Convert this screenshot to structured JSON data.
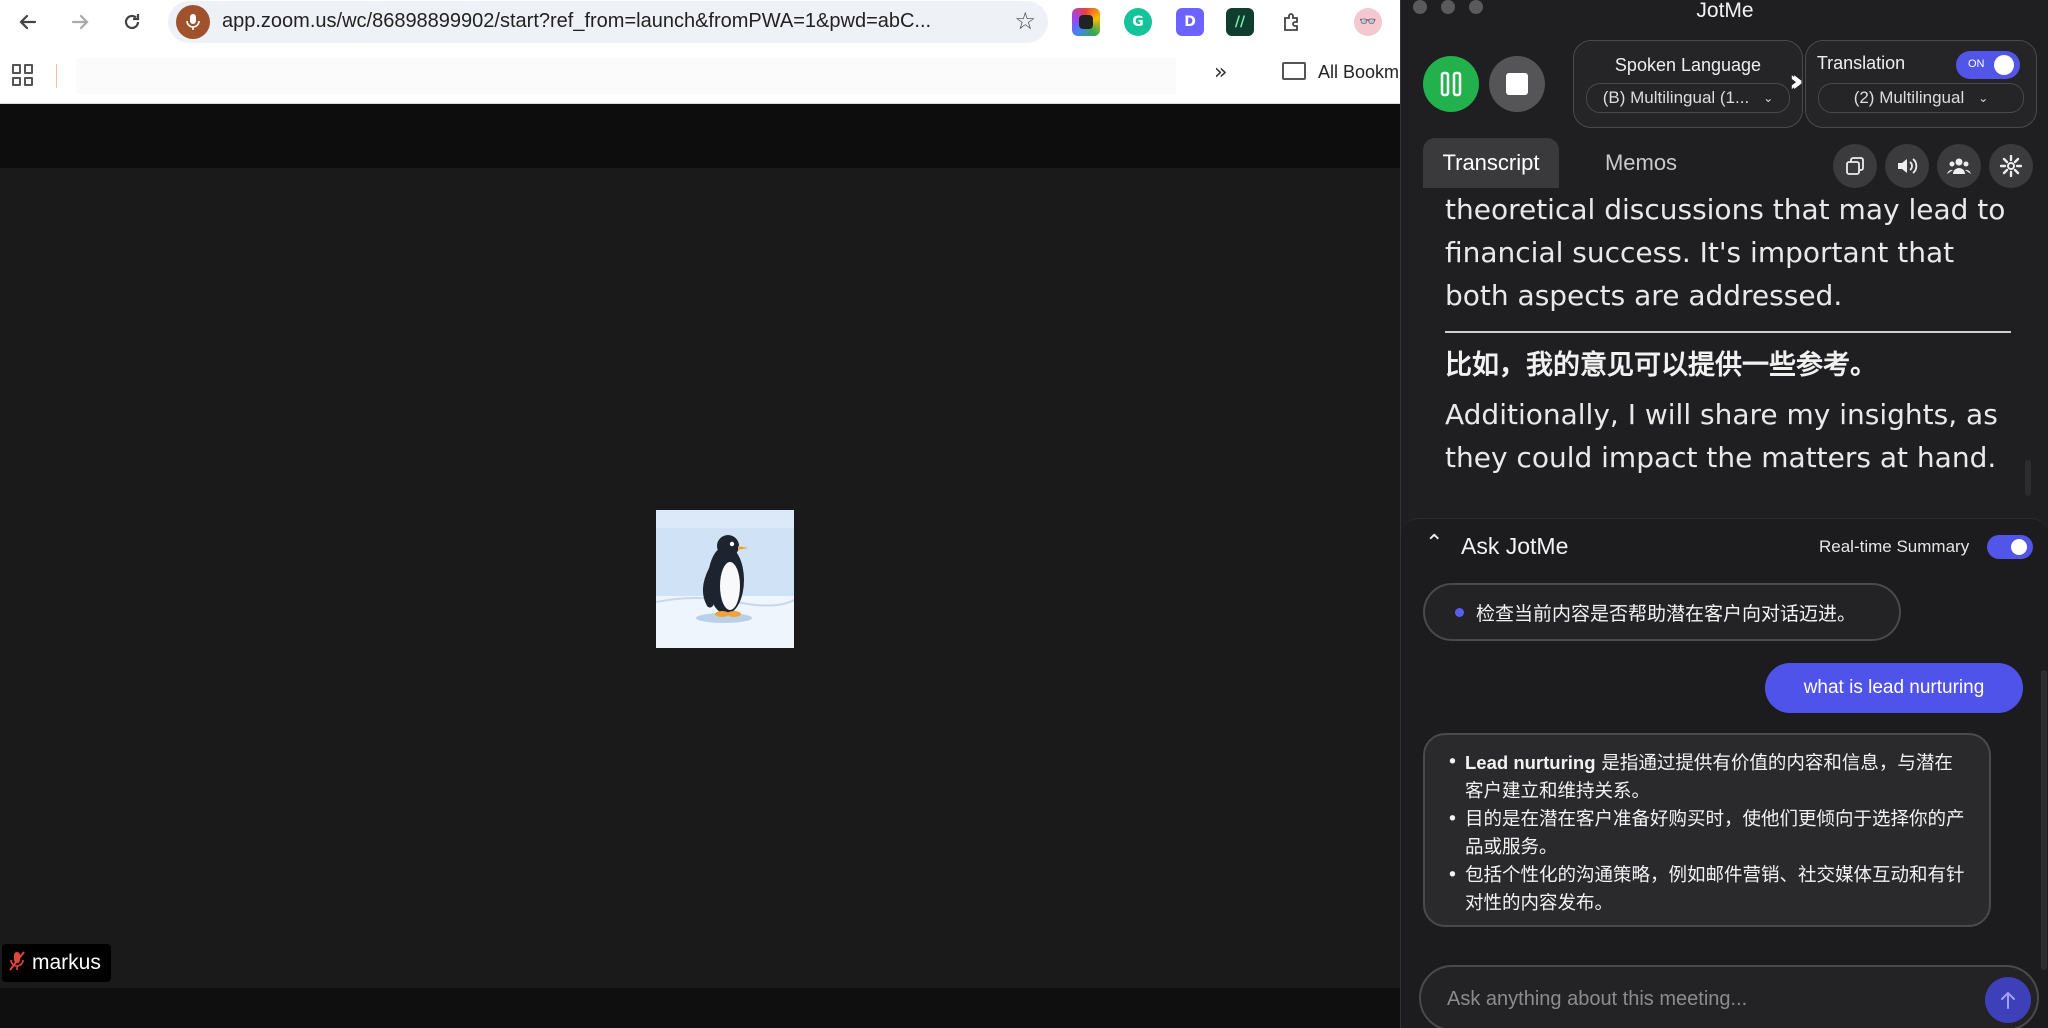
{
  "browser": {
    "url": "app.zoom.us/wc/86898899902/start?ref_from=launch&fromPWA=1&pwd=abC...",
    "bookmarks_label": "All Bookm"
  },
  "meeting": {
    "participant_name": "markus"
  },
  "jotme": {
    "title": "JotMe",
    "spoken_language_label": "Spoken Language",
    "spoken_language_value": "(B) Multilingual (1...",
    "translation_label": "Translation",
    "translation_toggle": "ON",
    "translation_value": "(2) Multilingual",
    "tabs": [
      "Transcript",
      "Memos"
    ],
    "transcript": {
      "segment_1": "theoretical discussions that may lead to financial success. It's important that both aspects are addressed.",
      "segment_2_original": "比如，我的意见可以提供一些参考。",
      "segment_2_translation": "Additionally, I will share my insights, as they could impact the matters at hand."
    },
    "ask": {
      "title": "Ask JotMe",
      "realtime_summary_label": "Real-time Summary",
      "suggestion": "检查当前内容是否帮助潜在客户向对话迈进。",
      "user_question": "what is lead nurturing",
      "answer": {
        "item_1_bold": "Lead nurturing",
        "item_1_rest": " 是指通过提供有价值的内容和信息，与潜在客户建立和维持关系。",
        "item_2": "目的是在潜在客户准备好购买时，使他们更倾向于选择你的产品或服务。",
        "item_3": "包括个性化的沟通策略，例如邮件营销、社交媒体互动和有针对性的内容发布。"
      },
      "input_placeholder": "Ask anything about this meeting..."
    },
    "colors": {
      "accent": "#5155e8",
      "record_green": "#22b14c",
      "panel_bg": "#1f1f21"
    }
  }
}
